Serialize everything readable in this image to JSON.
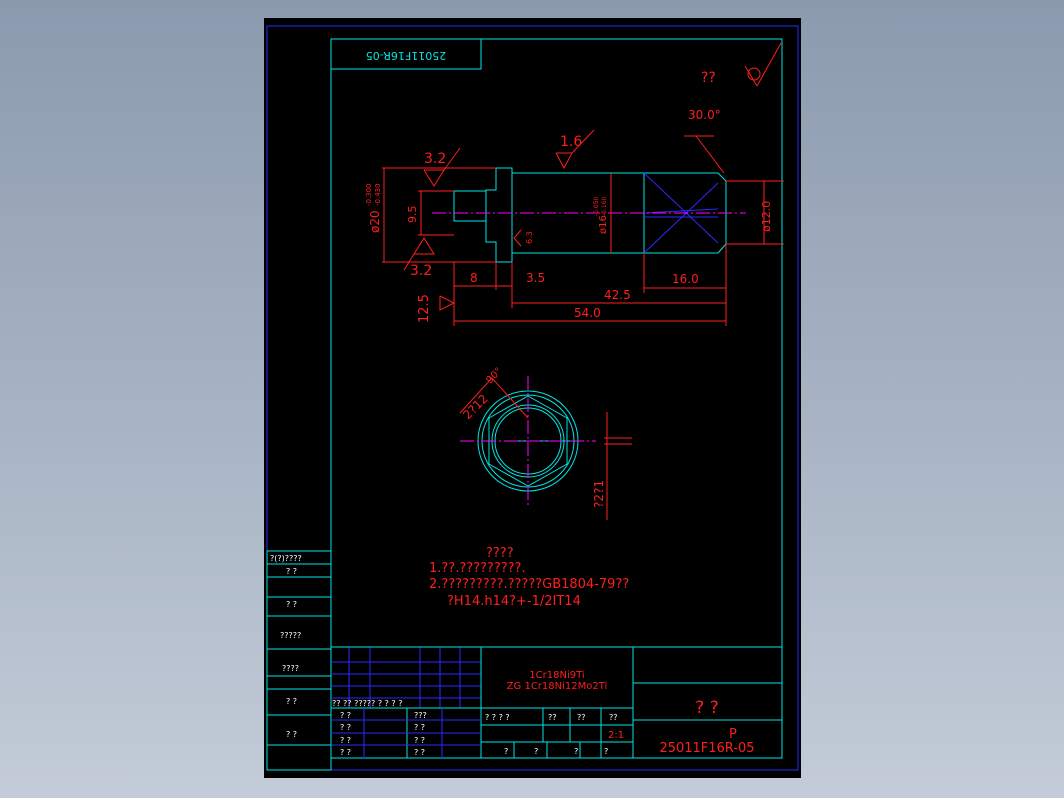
{
  "colors": {
    "cyan": "#00e5e5",
    "blue": "#2a2aff",
    "red": "#ff1e1e",
    "magenta": "#ff00ff",
    "white": "#ffffff",
    "background": "#000000"
  },
  "drawing_code_top": "25011F16R-05",
  "roughness": {
    "general": "??",
    "top": "3.2",
    "bottom": "3.2",
    "shaft": "1.6",
    "left": "12.5",
    "groove": "6.3"
  },
  "dimensions": {
    "chamfer_angle": "30.0°",
    "outer_dia": "ø20",
    "outer_dia_upper": "-0.300",
    "outer_dia_lower": "-0.430",
    "inner_height": "9.5",
    "shaft_dia": "ø16",
    "shaft_dia_upper": "-0.050",
    "shaft_dia_lower": "-0.160",
    "tip_dia": "ø12.0",
    "head_len": "8",
    "groove_len": "3.5",
    "tip_len": "16.0",
    "shaft_len": "42.5",
    "total_len": "54.0",
    "end_hex": "2?12",
    "end_angle": "90°",
    "end_slot": "?2?1"
  },
  "notes": {
    "heading": "????",
    "line1": "1.??.?????????.",
    "line2": "2.?????????.?????GB1804-79??",
    "line3": "?H14.h14?+-1/2IT14"
  },
  "left_strip": {
    "header": "?(?)????",
    "r1": "?   ?",
    "r2": "?   ?",
    "r3": "?????",
    "r4": "????",
    "r5": "?   ?",
    "r6": "?   ?"
  },
  "title_block": {
    "material1": "1Cr18Ni9Ti",
    "material2": "ZG 1Cr18Ni12Mo2Ti",
    "part_name": "?   ?",
    "code_label": "P",
    "drawing_code": "25011F16R-05",
    "scale": "2:1",
    "row_labels": "??  ??   ?????    ?  ?    ?  ?",
    "sign1": "?  ?",
    "sign2": "?  ?",
    "sign3": "?  ?",
    "sign4": "?  ?",
    "mid1": "???",
    "mid2": "?  ?",
    "mid3": "?  ?",
    "mid4": "?  ?",
    "stage_labels": "?  ?  ?  ?",
    "weight": "??",
    "scale_label": "??",
    "sheet_label": "??",
    "b1": "?",
    "b2": "?",
    "b3": "?",
    "b4": "?"
  }
}
